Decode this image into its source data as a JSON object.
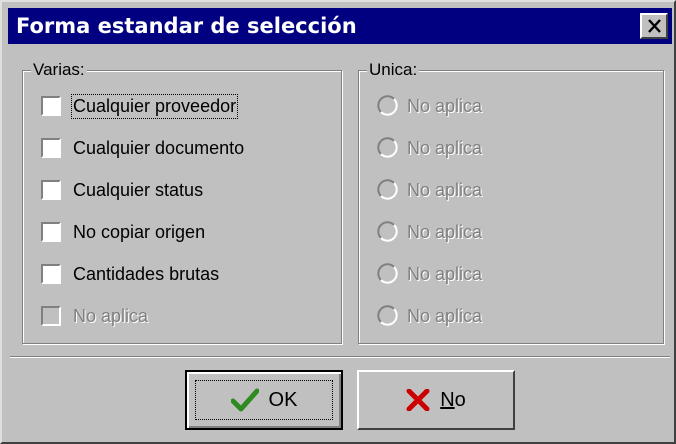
{
  "dialog": {
    "title": "Forma estandar de selección",
    "close_icon": "close-icon"
  },
  "varias": {
    "legend": "Varias:",
    "items": [
      {
        "label": "Cualquier proveedor",
        "checked": false,
        "enabled": true,
        "focused": true
      },
      {
        "label": "Cualquier documento",
        "checked": false,
        "enabled": true
      },
      {
        "label": "Cualquier status",
        "checked": false,
        "enabled": true
      },
      {
        "label": "No copiar origen",
        "checked": false,
        "enabled": true
      },
      {
        "label": "Cantidades brutas",
        "checked": false,
        "enabled": true
      },
      {
        "label": "No aplica",
        "checked": false,
        "enabled": false
      }
    ]
  },
  "unica": {
    "legend": "Unica:",
    "items": [
      {
        "label": "No aplica",
        "selected": false,
        "enabled": false
      },
      {
        "label": "No aplica",
        "selected": false,
        "enabled": false
      },
      {
        "label": "No aplica",
        "selected": false,
        "enabled": false
      },
      {
        "label": "No aplica",
        "selected": false,
        "enabled": false
      },
      {
        "label": "No aplica",
        "selected": false,
        "enabled": false
      },
      {
        "label": "No aplica",
        "selected": false,
        "enabled": false
      }
    ]
  },
  "buttons": {
    "ok_label": "OK",
    "ok_icon": "checkmark-icon",
    "no_mnemonic": "N",
    "no_rest": "o",
    "no_icon": "x-mark-icon"
  },
  "colors": {
    "titlebar": "#000080",
    "face": "#c0c0c0",
    "check_green": "#2e8b22",
    "x_red": "#cc0000",
    "disabled_text": "#808080"
  }
}
